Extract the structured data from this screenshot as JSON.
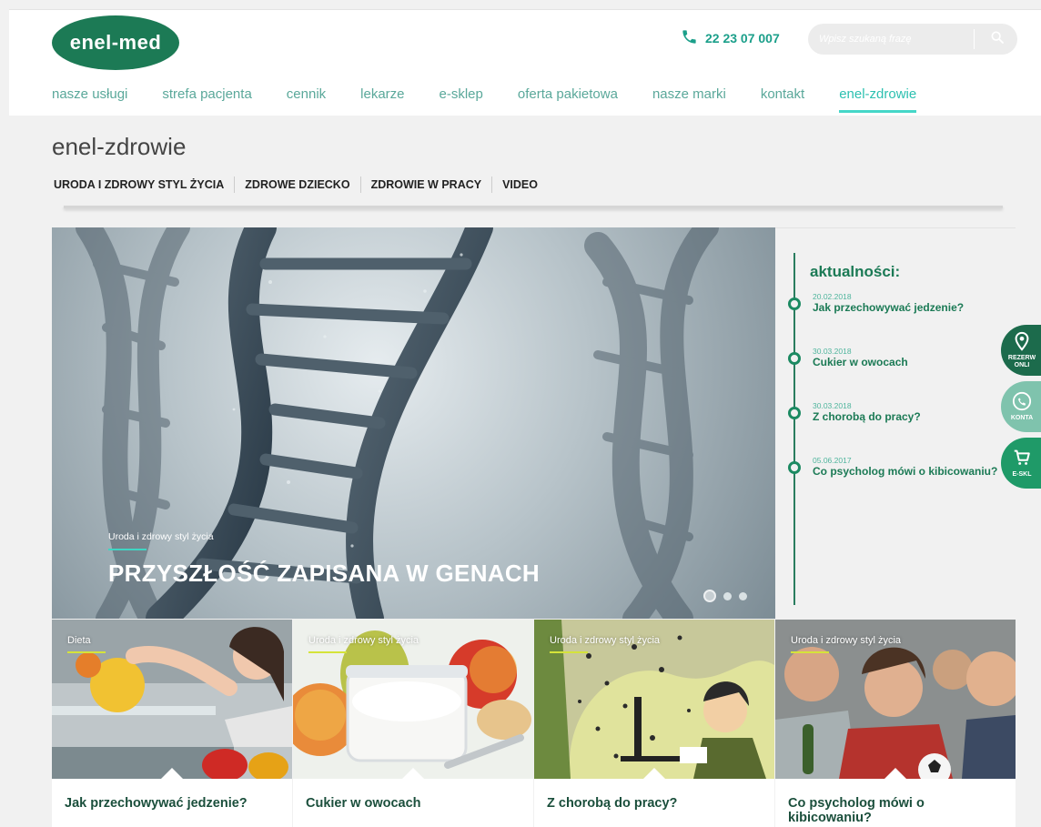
{
  "header": {
    "logo_text": "enel-med",
    "phone": "22 23 07 007",
    "search_placeholder": "Wpisz szukaną frazę"
  },
  "nav": {
    "items": [
      {
        "label": "nasze usługi"
      },
      {
        "label": "strefa pacjenta"
      },
      {
        "label": "cennik"
      },
      {
        "label": "lekarze"
      },
      {
        "label": "e-sklep"
      },
      {
        "label": "oferta pakietowa"
      },
      {
        "label": "nasze marki"
      },
      {
        "label": "kontakt"
      },
      {
        "label": "enel-zdrowie",
        "active": true
      }
    ]
  },
  "page": {
    "title": "enel-zdrowie",
    "subnav": [
      {
        "label": "URODA I ZDROWY STYL ŻYCIA"
      },
      {
        "label": "ZDROWE DZIECKO"
      },
      {
        "label": "ZDROWIE W PRACY"
      },
      {
        "label": "VIDEO"
      }
    ]
  },
  "hero": {
    "category": "Uroda i zdrowy styl życia",
    "title": "PRZYSZŁOŚĆ ZAPISANA W GENACH",
    "slides_count": 3,
    "active_slide": 1
  },
  "news": {
    "heading": "aktualności:",
    "items": [
      {
        "date": "20.02.2018",
        "title": "Jak przechowywać jedzenie?"
      },
      {
        "date": "30.03.2018",
        "title": "Cukier w owocach"
      },
      {
        "date": "30.03.2018",
        "title": "Z chorobą do pracy?"
      },
      {
        "date": "05.06.2017",
        "title": "Co psycholog mówi o kibicowaniu?"
      }
    ]
  },
  "side_buttons": {
    "reserve": {
      "line1": "REZERW",
      "line2": "ONLI"
    },
    "contact": {
      "label": "KONTA"
    },
    "shop": {
      "label": "E-SKL"
    }
  },
  "cards": [
    {
      "category": "Dieta",
      "title": "Jak przechowywać jedzenie?"
    },
    {
      "category": "Uroda i zdrowy styl życia",
      "title": "Cukier w owocach"
    },
    {
      "category": "Uroda i zdrowy styl życia",
      "title": "Z chorobą do pracy?"
    },
    {
      "category": "Uroda i zdrowy styl życia",
      "title": "Co psycholog mówi o kibicowaniu?"
    }
  ],
  "colors": {
    "brand_green": "#1c7a55",
    "accent_teal": "#2cc0b0",
    "nav_text": "#5aa89a",
    "card_title": "#1b4f3c"
  }
}
